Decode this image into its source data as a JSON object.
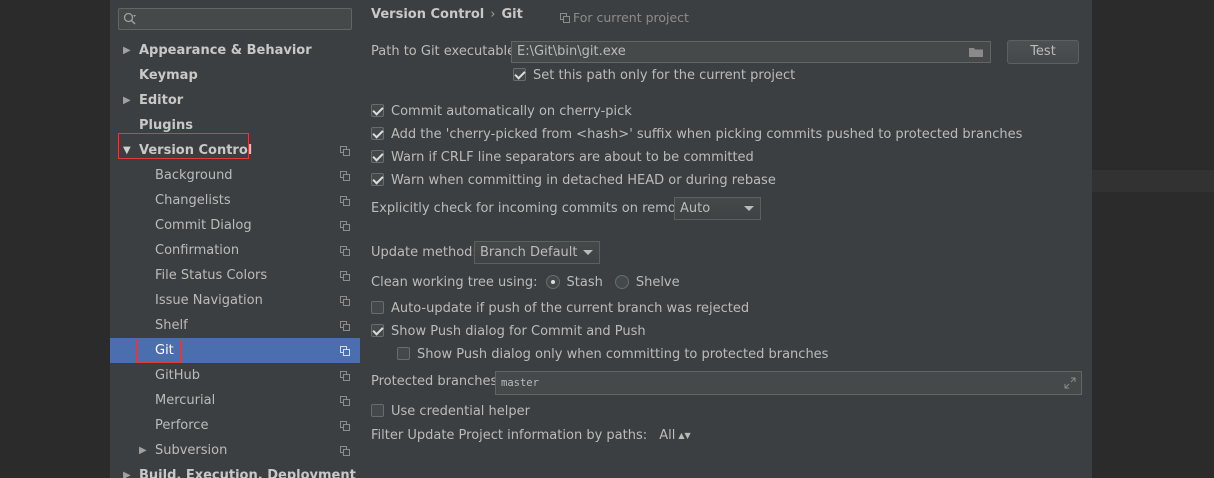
{
  "sidebar": {
    "search_placeholder": "",
    "items": [
      {
        "label": "Appearance & Behavior",
        "level": 0,
        "bold": true,
        "arrow": "right"
      },
      {
        "label": "Keymap",
        "level": 0,
        "bold": true,
        "arrow": ""
      },
      {
        "label": "Editor",
        "level": 0,
        "bold": true,
        "arrow": "right"
      },
      {
        "label": "Plugins",
        "level": 0,
        "bold": true,
        "arrow": ""
      },
      {
        "label": "Version Control",
        "level": 0,
        "bold": true,
        "arrow": "down"
      },
      {
        "label": "Background",
        "level": 1
      },
      {
        "label": "Changelists",
        "level": 1
      },
      {
        "label": "Commit Dialog",
        "level": 1
      },
      {
        "label": "Confirmation",
        "level": 1
      },
      {
        "label": "File Status Colors",
        "level": 1
      },
      {
        "label": "Issue Navigation",
        "level": 1
      },
      {
        "label": "Shelf",
        "level": 1
      },
      {
        "label": "Git",
        "level": 1,
        "selected": true
      },
      {
        "label": "GitHub",
        "level": 1
      },
      {
        "label": "Mercurial",
        "level": 1
      },
      {
        "label": "Perforce",
        "level": 1
      },
      {
        "label": "Subversion",
        "level": 1,
        "arrow": "right"
      },
      {
        "label": "Build, Execution, Deployment",
        "level": 0,
        "bold": true,
        "arrow": "right"
      }
    ]
  },
  "header": {
    "crumb_parent": "Version Control",
    "crumb_sep": "›",
    "crumb_current": "Git",
    "for_project": "For current project"
  },
  "git": {
    "path_label": "Path to Git executable:",
    "path_value": "E:\\Git\\bin\\git.exe",
    "test_label": "Test",
    "set_path_only": "Set this path only for the current project",
    "commit_cherry_pick": "Commit automatically on cherry-pick",
    "cherry_picked_suffix": "Add the 'cherry-picked from <hash>' suffix when picking commits pushed to protected branches",
    "warn_crlf": "Warn if CRLF line separators are about to be committed",
    "warn_detached": "Warn when committing in detached HEAD or during rebase",
    "incoming_label": "Explicitly check for incoming commits on remotes:",
    "incoming_value": "Auto",
    "update_method_label": "Update method:",
    "update_method_value": "Branch Default",
    "clean_tree_label": "Clean working tree using:",
    "stash_label": "Stash",
    "shelve_label": "Shelve",
    "auto_update": "Auto-update if push of the current branch was rejected",
    "show_push": "Show Push dialog for Commit and Push",
    "show_push_protected": "Show Push dialog only when committing to protected branches",
    "protected_label": "Protected branches:",
    "protected_value": "master",
    "credential_helper": "Use credential helper",
    "filter_label": "Filter Update Project information by paths:",
    "filter_value": "All"
  },
  "colors": {
    "selection": "#4b6eaf",
    "highlight_box": "#e0393e",
    "panel": "#3c3f41"
  }
}
